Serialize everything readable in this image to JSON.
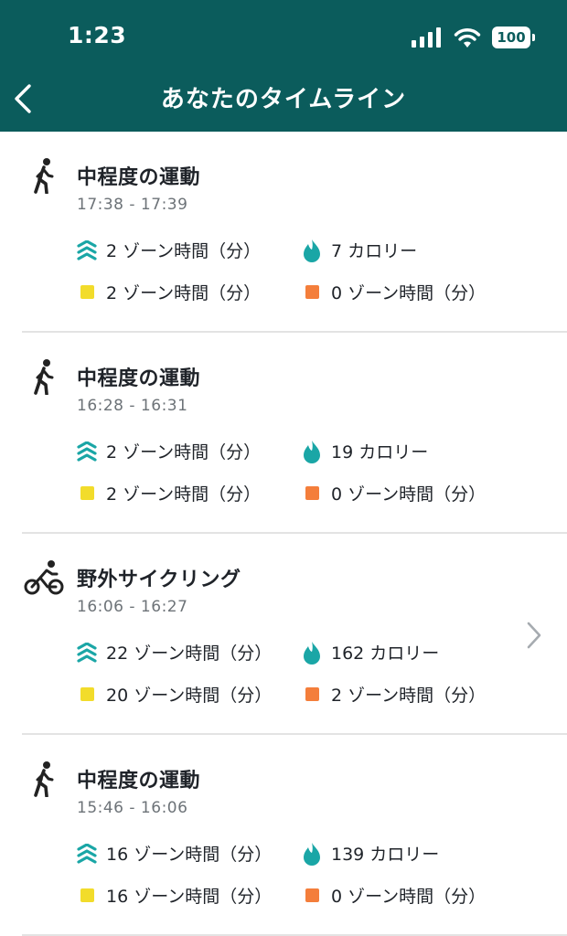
{
  "status_bar": {
    "time": "1:23",
    "battery": "100"
  },
  "nav": {
    "title": "あなたのタイムライン"
  },
  "colors": {
    "header_bg": "#0b5c5c",
    "zone_teal": "#1aa6a6",
    "yellow": "#f2dc2b",
    "orange": "#f47e3b"
  },
  "entries": [
    {
      "icon": "walk-icon",
      "title": "中程度の運動",
      "time": "17:38 - 17:39",
      "zone_minutes": "2 ゾーン時間（分）",
      "calories": "7 カロリー",
      "yellow_minutes": "2 ゾーン時間（分）",
      "orange_minutes": "0 ゾーン時間（分）"
    },
    {
      "icon": "walk-icon",
      "title": "中程度の運動",
      "time": "16:28 - 16:31",
      "zone_minutes": "2 ゾーン時間（分）",
      "calories": "19 カロリー",
      "yellow_minutes": "2 ゾーン時間（分）",
      "orange_minutes": "0 ゾーン時間（分）"
    },
    {
      "icon": "bike-icon",
      "title": "野外サイクリング",
      "time": "16:06 - 16:27",
      "zone_minutes": "22 ゾーン時間（分）",
      "calories": "162 カロリー",
      "yellow_minutes": "20 ゾーン時間（分）",
      "orange_minutes": "2 ゾーン時間（分）",
      "has_chevron": true
    },
    {
      "icon": "walk-icon",
      "title": "中程度の運動",
      "time": "15:46 - 16:06",
      "zone_minutes": "16 ゾーン時間（分）",
      "calories": "139 カロリー",
      "yellow_minutes": "16 ゾーン時間（分）",
      "orange_minutes": "0 ゾーン時間（分）"
    }
  ]
}
